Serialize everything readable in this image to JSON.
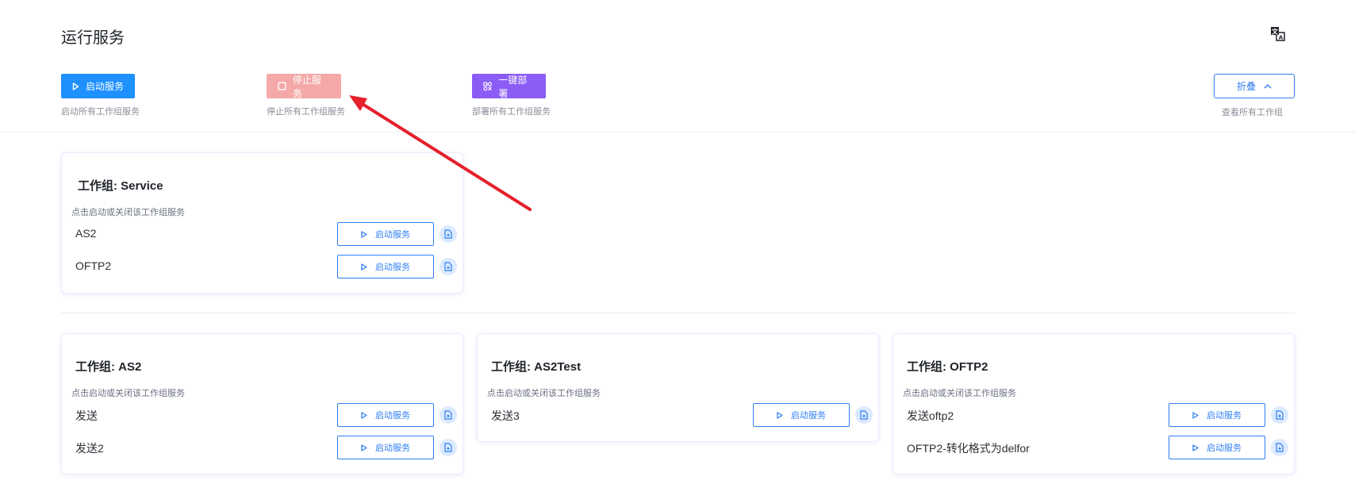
{
  "header": {
    "title": "运行服务",
    "translate_icon": "translate-icon"
  },
  "actions": {
    "start": {
      "label": "启动服务",
      "desc": "启动所有工作组服务",
      "icon": "play-icon",
      "color": "#1e90ff"
    },
    "stop": {
      "label": "停止服务",
      "desc": "停止所有工作组服务",
      "icon": "stop-icon",
      "color": "#f4a9a8"
    },
    "deploy": {
      "label": "一键部署",
      "desc": "部署所有工作组服务",
      "icon": "deploy-icon",
      "color": "#8b5cf6"
    },
    "collapse": {
      "label": "折叠",
      "desc": "查看所有工作组",
      "icon": "chevron-up-icon"
    }
  },
  "groups": [
    {
      "title": "工作组: Service",
      "subtitle": "点击启动或关闭该工作组服务",
      "services": [
        {
          "name": "AS2",
          "button": "启动服务"
        },
        {
          "name": "OFTP2",
          "button": "启动服务"
        }
      ]
    },
    {
      "title": "工作组: AS2",
      "subtitle": "点击启动或关闭该工作组服务",
      "services": [
        {
          "name": "发送",
          "button": "启动服务"
        },
        {
          "name": "发送2",
          "button": "启动服务"
        }
      ]
    },
    {
      "title": "工作组: AS2Test",
      "subtitle": "点击启动或关闭该工作组服务",
      "services": [
        {
          "name": "发送3",
          "button": "启动服务"
        }
      ]
    },
    {
      "title": "工作组: OFTP2",
      "subtitle": "点击启动或关闭该工作组服务",
      "services": [
        {
          "name": "发送oftp2",
          "button": "启动服务"
        },
        {
          "name": "OFTP2-转化格式为delfor",
          "button": "启动服务"
        }
      ]
    }
  ],
  "annotation": {
    "color": "#e5202b"
  },
  "colors": {
    "primary": "#2f7ff1",
    "file_icon_bg": "#dceaff"
  }
}
